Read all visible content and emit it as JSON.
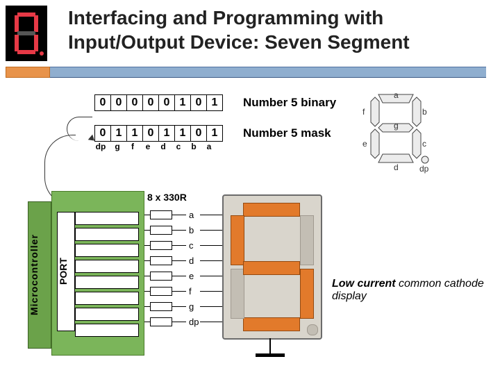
{
  "title": "Interfacing and Programming with Input/Output Device: Seven Segment",
  "binary_row": [
    "0",
    "0",
    "0",
    "0",
    "0",
    "1",
    "0",
    "1"
  ],
  "mask_row": [
    "0",
    "1",
    "1",
    "0",
    "1",
    "1",
    "0",
    "1"
  ],
  "bit_labels": [
    "dp",
    "g",
    "f",
    "e",
    "d",
    "c",
    "b",
    "a"
  ],
  "row1_label": "Number 5 binary",
  "row2_label": "Number 5 mask",
  "segmap_labels": {
    "a": "a",
    "b": "b",
    "c": "c",
    "d": "d",
    "e": "e",
    "f": "f",
    "g": "g",
    "dp": "dp"
  },
  "micro_label": "Microcontroller",
  "port_label": "PORT",
  "resistor_label": "8 x 330R",
  "pin_labels": [
    "a",
    "b",
    "c",
    "d",
    "e",
    "f",
    "g",
    "dp"
  ],
  "caption_bold": "Low current",
  "caption_rest": " common cathode display",
  "chart_data": {
    "type": "table",
    "title": "Seven-segment encoding for digit 5",
    "bit_order_msb_to_lsb": [
      "dp",
      "g",
      "f",
      "e",
      "d",
      "c",
      "b",
      "a"
    ],
    "number_5_binary_value": [
      0,
      0,
      0,
      0,
      0,
      1,
      0,
      1
    ],
    "number_5_mask_value": [
      0,
      1,
      1,
      0,
      1,
      1,
      0,
      1
    ],
    "segments_on_for_5": [
      "a",
      "c",
      "d",
      "f",
      "g"
    ],
    "segments_off_for_5": [
      "b",
      "e",
      "dp"
    ],
    "resistor_value_ohms": 330,
    "resistor_count": 8,
    "display_type": "common cathode"
  }
}
